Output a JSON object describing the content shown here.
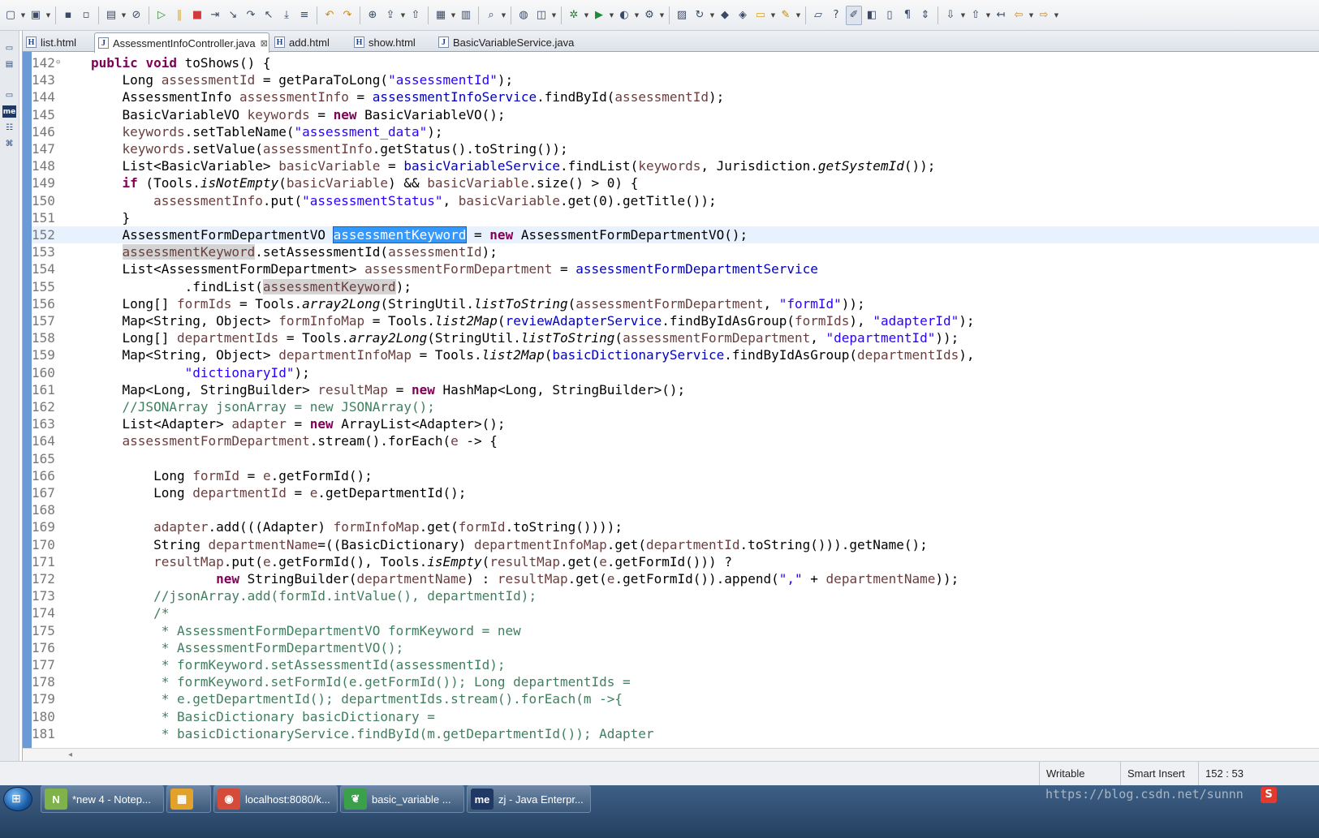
{
  "toolbar": {
    "icons": [
      "new-icon",
      "new-wizard-icon",
      "save-icon",
      "save-all-icon",
      "console-icon",
      "skip-breakpoints-icon",
      "resume-icon",
      "suspend-icon",
      "terminate-icon",
      "disconnect-icon",
      "step-into-icon",
      "step-over-icon",
      "step-return-icon",
      "drop-to-frame-icon",
      "use-step-filters-icon",
      "undo-icon",
      "redo-icon",
      "new-server-icon",
      "deploy-icon",
      "publish-icon",
      "grid-icon",
      "table-icon",
      "search-icon",
      "globe-icon",
      "camera-icon",
      "debug-icon",
      "run-icon",
      "coverage-icon",
      "external-tools-icon",
      "new-package-icon",
      "refresh-icon",
      "open-type-icon",
      "open-task-icon",
      "open-folder-icon",
      "pencil-icon",
      "open-resource-icon",
      "help-icon",
      "mark-occurrences-icon",
      "toggle-highlight-icon",
      "block-selection-icon",
      "word-wrap-icon",
      "show-whitespace-icon",
      "next-annotation-icon",
      "prev-annotation-icon",
      "last-edit-icon",
      "back-icon",
      "forward-icon"
    ]
  },
  "tabs": [
    {
      "label": "list.html",
      "icon": "H",
      "active": false
    },
    {
      "label": "AssessmentInfoController.java",
      "icon": "J",
      "active": true,
      "close": "⊠"
    },
    {
      "label": "add.html",
      "icon": "H",
      "active": false
    },
    {
      "label": "show.html",
      "icon": "H",
      "active": false
    },
    {
      "label": "BasicVariableService.java",
      "icon": "J",
      "active": false
    }
  ],
  "code": {
    "current_line": 152,
    "lines": [
      {
        "n": "142",
        "fold": "⊖",
        "html": "<span class='kw'>public</span> <span class='kw'>void</span> toShows() {"
      },
      {
        "n": "143",
        "html": "    Long <span class='var'>assessmentId</span> = getParaToLong(<span class='str'>\"assessmentId\"</span>);"
      },
      {
        "n": "144",
        "html": "    AssessmentInfo <span class='var'>assessmentInfo</span> = <span class='fld'>assessmentInfoService</span>.findById(<span class='var'>assessmentId</span>);"
      },
      {
        "n": "145",
        "html": "    BasicVariableVO <span class='var'>keywords</span> = <span class='kw'>new</span> BasicVariableVO();"
      },
      {
        "n": "146",
        "html": "    <span class='var'>keywords</span>.setTableName(<span class='str'>\"assessment_data\"</span>);"
      },
      {
        "n": "147",
        "html": "    <span class='var'>keywords</span>.setValue(<span class='var'>assessmentInfo</span>.getStatus().toString());"
      },
      {
        "n": "148",
        "html": "    List&lt;BasicVariable&gt; <span class='var'>basicVariable</span> = <span class='fld'>basicVariableService</span>.findList(<span class='var'>keywords</span>, Jurisdiction.<span class='st'>getSystemId</span>());"
      },
      {
        "n": "149",
        "html": "    <span class='kw'>if</span> (Tools.<span class='st'>isNotEmpty</span>(<span class='var'>basicVariable</span>) &amp;&amp; <span class='var'>basicVariable</span>.size() &gt; 0) {"
      },
      {
        "n": "150",
        "html": "        <span class='var'>assessmentInfo</span>.put(<span class='str'>\"assessmentStatus\"</span>, <span class='var'>basicVariable</span>.get(0).getTitle());"
      },
      {
        "n": "151",
        "html": "    }"
      },
      {
        "n": "152",
        "html": "    AssessmentFormDepartmentVO <span class='sel'>assessmentKeyword</span> = <span class='kw'>new</span> AssessmentFormDepartmentVO();"
      },
      {
        "n": "153",
        "html": "    <span class='var occ'>assessmentKeyword</span>.setAssessmentId(<span class='var'>assessmentId</span>);"
      },
      {
        "n": "154",
        "html": "    List&lt;AssessmentFormDepartment&gt; <span class='var'>assessmentFormDepartment</span> = <span class='fld'>assessmentFormDepartmentService</span>"
      },
      {
        "n": "155",
        "html": "            .findList(<span class='var occ'>assessmentKeyword</span>);"
      },
      {
        "n": "156",
        "html": "    Long[] <span class='var'>formIds</span> = Tools.<span class='st'>array2Long</span>(StringUtil.<span class='st'>listToString</span>(<span class='var'>assessmentFormDepartment</span>, <span class='str'>\"formId\"</span>));"
      },
      {
        "n": "157",
        "html": "    Map&lt;String, Object&gt; <span class='var'>formInfoMap</span> = Tools.<span class='st'>list2Map</span>(<span class='fld'>reviewAdapterService</span>.findByIdAsGroup(<span class='var'>formIds</span>), <span class='str'>\"adapterId\"</span>);"
      },
      {
        "n": "158",
        "html": "    Long[] <span class='var'>departmentIds</span> = Tools.<span class='st'>array2Long</span>(StringUtil.<span class='st'>listToString</span>(<span class='var'>assessmentFormDepartment</span>, <span class='str'>\"departmentId\"</span>));"
      },
      {
        "n": "159",
        "html": "    Map&lt;String, Object&gt; <span class='var'>departmentInfoMap</span> = Tools.<span class='st'>list2Map</span>(<span class='fld'>basicDictionaryService</span>.findByIdAsGroup(<span class='var'>departmentIds</span>),"
      },
      {
        "n": "160",
        "html": "            <span class='str'>\"dictionaryId\"</span>);"
      },
      {
        "n": "161",
        "html": "    Map&lt;Long, StringBuilder&gt; <span class='var'>resultMap</span> = <span class='kw'>new</span> HashMap&lt;Long, StringBuilder&gt;();"
      },
      {
        "n": "162",
        "html": "    <span class='cm'>//JSONArray jsonArray = new JSONArray();</span>"
      },
      {
        "n": "163",
        "html": "    List&lt;Adapter&gt; <span class='var'>adapter</span> = <span class='kw'>new</span> ArrayList&lt;Adapter&gt;();"
      },
      {
        "n": "164",
        "html": "    <span class='var'>assessmentFormDepartment</span>.stream().forEach(<span class='var'>e</span> -&gt; {"
      },
      {
        "n": "165",
        "html": ""
      },
      {
        "n": "166",
        "html": "        Long <span class='var'>formId</span> = <span class='var'>e</span>.getFormId();"
      },
      {
        "n": "167",
        "html": "        Long <span class='var'>departmentId</span> = <span class='var'>e</span>.getDepartmentId();"
      },
      {
        "n": "168",
        "html": ""
      },
      {
        "n": "169",
        "html": "        <span class='var'>adapter</span>.add(((Adapter) <span class='var'>formInfoMap</span>.get(<span class='var'>formId</span>.toString())));"
      },
      {
        "n": "170",
        "html": "        String <span class='var'>departmentName</span>=((BasicDictionary) <span class='var'>departmentInfoMap</span>.get(<span class='var'>departmentId</span>.toString())).getName();"
      },
      {
        "n": "171",
        "html": "        <span class='var'>resultMap</span>.put(<span class='var'>e</span>.getFormId(), Tools.<span class='st'>isEmpty</span>(<span class='var'>resultMap</span>.get(<span class='var'>e</span>.getFormId())) ?"
      },
      {
        "n": "172",
        "html": "                <span class='kw'>new</span> StringBuilder(<span class='var'>departmentName</span>) : <span class='var'>resultMap</span>.get(<span class='var'>e</span>.getFormId()).append(<span class='str'>\",\"</span> + <span class='var'>departmentName</span>));"
      },
      {
        "n": "173",
        "html": "        <span class='cm'>//jsonArray.add(formId.intValue(), departmentId);</span>"
      },
      {
        "n": "174",
        "html": "        <span class='cm'>/*</span>"
      },
      {
        "n": "175",
        "html": "<span class='cm'>         * AssessmentFormDepartmentVO formKeyword = new</span>"
      },
      {
        "n": "176",
        "html": "<span class='cm'>         * AssessmentFormDepartmentVO();</span>"
      },
      {
        "n": "177",
        "html": "<span class='cm'>         * formKeyword.setAssessmentId(assessmentId);</span>"
      },
      {
        "n": "178",
        "html": "<span class='cm'>         * formKeyword.setFormId(e.getFormId()); Long departmentIds =</span>"
      },
      {
        "n": "179",
        "html": "<span class='cm'>         * e.getDepartmentId(); departmentIds.stream().forEach(m -&gt;{</span>"
      },
      {
        "n": "180",
        "html": "<span class='cm'>         * BasicDictionary basicDictionary =</span>"
      },
      {
        "n": "181",
        "html": "<span class='cm'>         * basicDictionaryService.findById(m.getDepartmentId()); Adapter</span>"
      }
    ]
  },
  "status": {
    "writable": "Writable",
    "insert_mode": "Smart Insert",
    "cursor_position": "152 : 53"
  },
  "taskbar": {
    "items": [
      {
        "label": "*new 4 - Notep...",
        "icon": "notepad-icon",
        "glyph": "N",
        "color": "#7fb24a"
      },
      {
        "label": "",
        "icon": "windows-app-icon",
        "glyph": "▦",
        "color": "#e1a12a"
      },
      {
        "label": "localhost:8080/k...",
        "icon": "chrome-icon",
        "glyph": "◉",
        "color": "#d64a3a"
      },
      {
        "label": "basic_variable ...",
        "icon": "navicat-icon",
        "glyph": "❦",
        "color": "#3aa14a"
      },
      {
        "label": "zj - Java Enterpr...",
        "icon": "myeclipse-icon",
        "glyph": "me",
        "color": "#1f3864"
      }
    ],
    "watermark": "https://blog.csdn.net/sunnn",
    "ime_glyph": "S"
  }
}
